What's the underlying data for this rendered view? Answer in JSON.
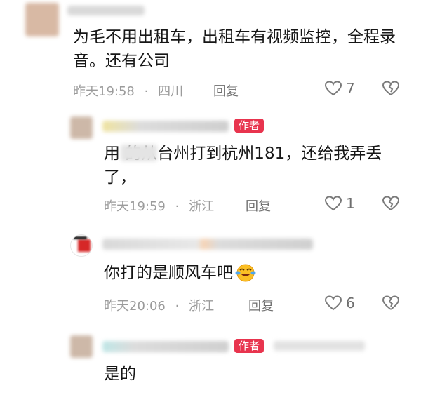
{
  "comments": [
    {
      "text": "为毛不用出租车，出租车有视频监控，全程录音。还有公司",
      "time": "昨天19:58",
      "location": "四川",
      "reply_label": "回复",
      "likes": "7",
      "is_author": false
    },
    {
      "text": "用                的从台州打到杭州181，还给我弄丢了，",
      "time": "昨天19:59",
      "location": "浙江",
      "reply_label": "回复",
      "likes": "1",
      "is_author": true,
      "badge": "作者"
    },
    {
      "text": "你打的是顺风车吧",
      "time": "昨天20:06",
      "location": "浙江",
      "reply_label": "回复",
      "likes": "6",
      "is_author": false
    },
    {
      "text": "是的",
      "is_author": true,
      "badge": "作者"
    }
  ],
  "separator": "·",
  "colors": {
    "badge": "#e8344e",
    "meta": "#9b9b9b",
    "text": "#161616"
  },
  "icons": {
    "like": "heart-outline-icon",
    "dislike": "broken-heart-icon",
    "emoji": "laughing-tears-emoji"
  }
}
